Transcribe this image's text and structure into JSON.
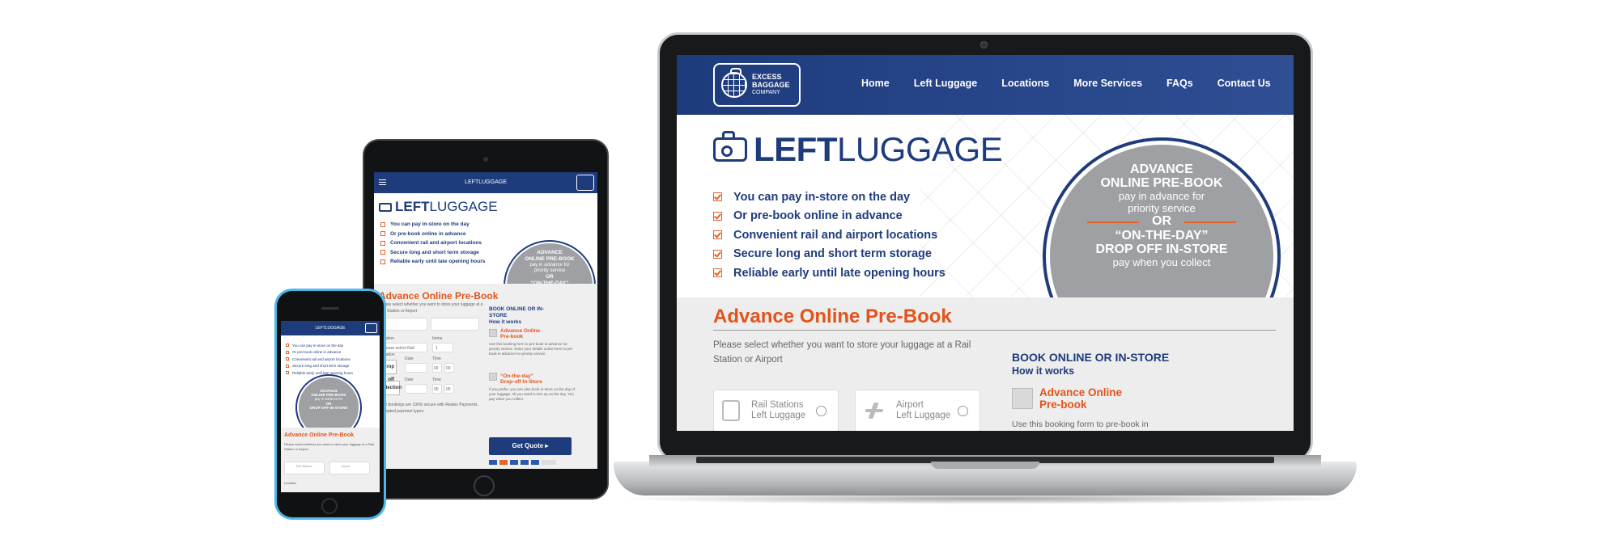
{
  "site": {
    "logo": {
      "line1": "EXCESS",
      "line2": "BAGGAGE",
      "line3": "COMPANY"
    },
    "nav": [
      "Home",
      "Left Luggage",
      "Locations",
      "More Services",
      "FAQs",
      "Contact Us"
    ],
    "hero": {
      "title_bold": "LEFT",
      "title_light": "LUGGAGE",
      "features": [
        "You can pay in-store on the day",
        "Or pre-book online in advance",
        "Convenient rail and airport locations",
        "Secure long and short term storage",
        "Reliable early until late opening hours"
      ],
      "circle": {
        "line1": "ADVANCE",
        "line2": "ONLINE PRE-BOOK",
        "line3": "pay in advance for",
        "line4": "priority service",
        "or": "OR",
        "line5": "“ON-THE-DAY”",
        "line6": "DROP OFF IN-STORE",
        "line7": "pay when you collect"
      }
    },
    "booking": {
      "title": "Advance Online Pre-Book",
      "description": "Please select whether you want to store your luggage at a Rail Station or Airport",
      "options": [
        {
          "line1": "Rail Stations",
          "line2": "Left Luggage"
        },
        {
          "line1": "Airport",
          "line2": "Left Luggage"
        }
      ],
      "how": {
        "heading": "BOOK ONLINE OR IN-STORE",
        "subheading": "How it works",
        "step1_line1": "Advance Online",
        "step1_line2": "Pre-book",
        "step1_desc": "Use this booking form to pre-book in advance for priority service. Enter your"
      }
    }
  },
  "tablet": {
    "header_logo": "LEFTLUGGAGE",
    "location_label": "Location",
    "location_placeholder": "Please select Rail Station",
    "items_label": "Items",
    "items_value": "1",
    "drop_off_label": "Drop off",
    "collection_label": "Collection",
    "date_label": "Date",
    "time_label": "Time",
    "time_value": "00",
    "how_heading_line1": "BOOK ONLINE OR IN-",
    "how_heading_line2": "STORE",
    "how_sub": "How it works",
    "step1_line1": "Advance Online",
    "step1_line2": "Pre-book",
    "step1_desc": "Use this booking form to pre-book in advance for priority service. Enter your details online here to pre-book in advance for priority service.",
    "step2_line1": "“On-the-day”",
    "step2_line2": "Drop-off In-Store",
    "step2_desc": "If you prefer, you can also book in-store on the day of your luggage. All you need is turn up on the day. You pay when you collect.",
    "quote_button": "Get Quote",
    "secure_note": "Your bookings are 100% secure with Realex Payments. Accepted payment types:",
    "desc": "Please select whether you want to store your luggage at a Rail Station or Airport"
  },
  "phone": {
    "header_logo": "LEFTLUGGAGE",
    "location_label": "Location"
  }
}
